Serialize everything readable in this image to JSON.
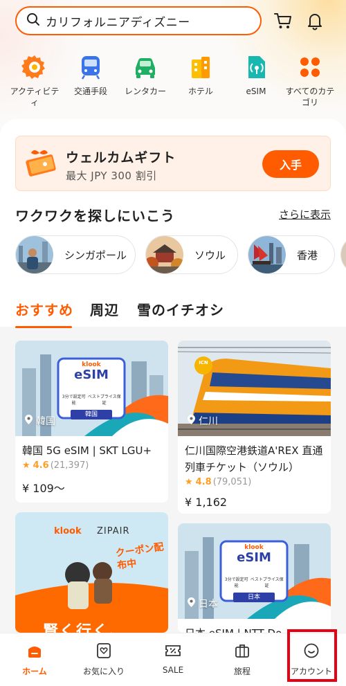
{
  "search": {
    "query": "カリフォルニアディズニー"
  },
  "header_icons": {
    "cart": "cart-icon",
    "bell": "bell-icon"
  },
  "categories": [
    {
      "label": "アクティビティ",
      "icon": "activity-icon"
    },
    {
      "label": "交通手段",
      "icon": "train-icon"
    },
    {
      "label": "レンタカー",
      "icon": "car-icon"
    },
    {
      "label": "ホテル",
      "icon": "hotel-icon"
    },
    {
      "label": "eSIM",
      "icon": "esim-icon"
    },
    {
      "label": "すべてのカテゴリ",
      "icon": "grid-icon"
    }
  ],
  "gift": {
    "title": "ウェルカムギフト",
    "subtitle": "最大 JPY 300 割引",
    "button": "入手"
  },
  "explore": {
    "heading": "ワクワクを探しにいこう",
    "more": "さらに表示",
    "chips": [
      "シンガポール",
      "ソウル",
      "香港"
    ]
  },
  "tabs": [
    "おすすめ",
    "周辺",
    "雪のイチオシ"
  ],
  "cards": [
    {
      "location": "韓国",
      "name": "韓国 5G eSIM | SKT LGU+",
      "score": "4.6",
      "reviews": "(21,397)",
      "price": "¥ 109〜",
      "badge_brand": "klook",
      "badge_title": "eSIM",
      "badge_tag1": "3分で設定可能",
      "badge_tag2": "ベストプライス保証",
      "badge_country": "韓国"
    },
    {
      "location": "仁川",
      "name": "仁川国際空港鉄道A'REX 直通列車チケット（ソウル）",
      "score": "4.8",
      "reviews": "(79,051)",
      "price": "¥ 1,162",
      "badge_airport": "ICN"
    },
    {
      "brand1": "klook",
      "brand2": "ZIPAIR",
      "promo": "クーポン配布中",
      "banner_text": "賢く行く、"
    },
    {
      "location": "日本",
      "name": "日本 eSIM | NTT Do",
      "badge_brand": "klook",
      "badge_title": "eSIM",
      "badge_tag1": "3分で設定可能",
      "badge_tag2": "ベストプライス保証",
      "badge_country": "日本"
    }
  ],
  "bottom_nav": [
    {
      "label": "ホーム",
      "icon": "home-icon",
      "active": true
    },
    {
      "label": "お気に入り",
      "icon": "favorites-icon",
      "active": false
    },
    {
      "label": "SALE",
      "icon": "sale-icon",
      "active": false
    },
    {
      "label": "旅程",
      "icon": "suitcase-icon",
      "active": false
    },
    {
      "label": "アカウント",
      "icon": "account-icon",
      "active": false
    }
  ],
  "colors": {
    "accent": "#ff5b00",
    "highlight": "#e60012"
  }
}
